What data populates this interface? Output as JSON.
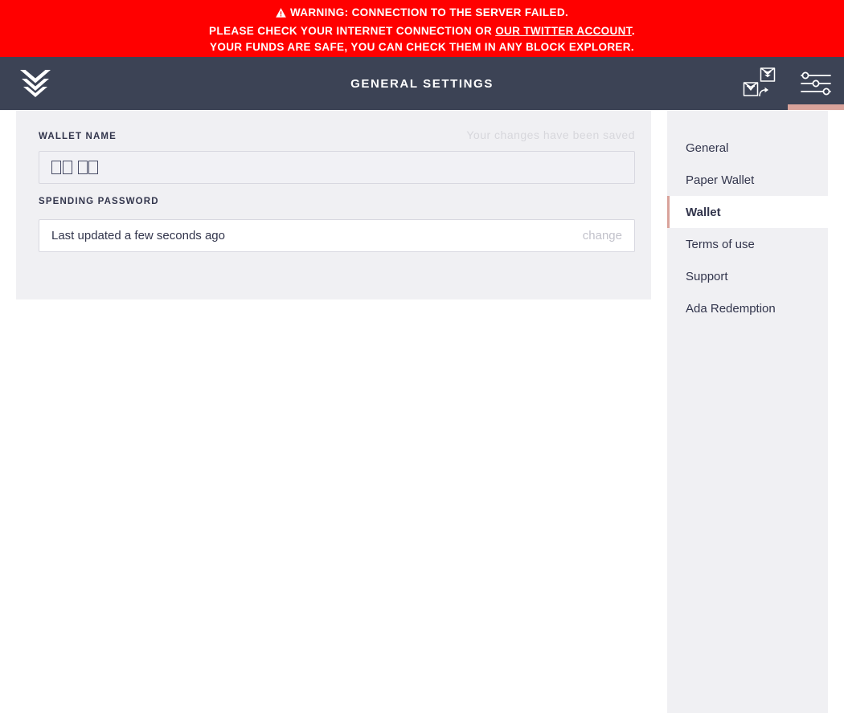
{
  "warning": {
    "icon": "warning-triangle-icon",
    "line1": "WARNING: CONNECTION TO THE SERVER FAILED.",
    "line2_pre": "PLEASE CHECK YOUR INTERNET CONNECTION OR ",
    "line2_link": "OUR TWITTER ACCOUNT",
    "line2_post": ".",
    "line3": "YOUR FUNDS ARE SAFE, YOU CAN CHECK THEM IN ANY BLOCK EXPLORER.",
    "background_color": "#ff0000",
    "text_color": "#ffffff"
  },
  "topbar": {
    "logo": "daedalus-chevron-logo",
    "title": "GENERAL SETTINGS",
    "background_color": "#3c4355",
    "active_indicator_color": "#d9a39b",
    "actions": [
      {
        "name": "wallet-switch-icon",
        "active": false
      },
      {
        "name": "settings-sliders-icon",
        "active": true
      }
    ]
  },
  "content": {
    "wallet_name": {
      "label": "WALLET NAME",
      "saved_message": "Your changes have been saved",
      "value_glyphs": 4,
      "value": "□□ □□"
    },
    "spending_password": {
      "label": "SPENDING PASSWORD",
      "status": "Last updated a few seconds ago",
      "change_label": "change"
    }
  },
  "settings_menu": {
    "items": [
      {
        "label": "General",
        "active": false
      },
      {
        "label": "Paper Wallet",
        "active": false
      },
      {
        "label": "Wallet",
        "active": true
      },
      {
        "label": "Terms of use",
        "active": false
      },
      {
        "label": "Support",
        "active": false
      },
      {
        "label": "Ada Redemption",
        "active": false
      }
    ]
  }
}
